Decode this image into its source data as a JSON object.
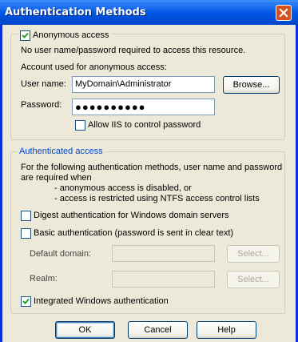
{
  "window": {
    "title": "Authentication Methods"
  },
  "anonymous": {
    "checkbox_label": "Anonymous access",
    "checked": true,
    "description": "No user name/password required to access this resource.",
    "account_label": "Account used for anonymous access:",
    "username_label": "User name:",
    "username_value": "MyDomain\\Administrator",
    "browse_label": "Browse...",
    "password_label": "Password:",
    "password_value": "●●●●●●●●●●",
    "allow_iis_label": "Allow IIS to control password",
    "allow_iis_checked": false
  },
  "authenticated": {
    "legend": "Authenticated access",
    "desc_line1": "For the following authentication methods, user name and password",
    "desc_line2": "are required when",
    "desc_bullet1": "- anonymous access is disabled, or",
    "desc_bullet2": "- access is restricted using NTFS access control lists",
    "digest_label": "Digest authentication for Windows domain servers",
    "digest_checked": false,
    "basic_label": "Basic authentication (password is sent in clear text)",
    "basic_checked": false,
    "default_domain_label": "Default domain:",
    "default_domain_value": "",
    "select1_label": "Select...",
    "realm_label": "Realm:",
    "realm_value": "",
    "select2_label": "Select...",
    "integrated_label": "Integrated Windows authentication",
    "integrated_checked": true
  },
  "footer": {
    "ok_label": "OK",
    "cancel_label": "Cancel",
    "help_label": "Help"
  },
  "colors": {
    "titlebar": "#0054e3",
    "accent_text": "#0046d5",
    "close": "#d9501f"
  }
}
